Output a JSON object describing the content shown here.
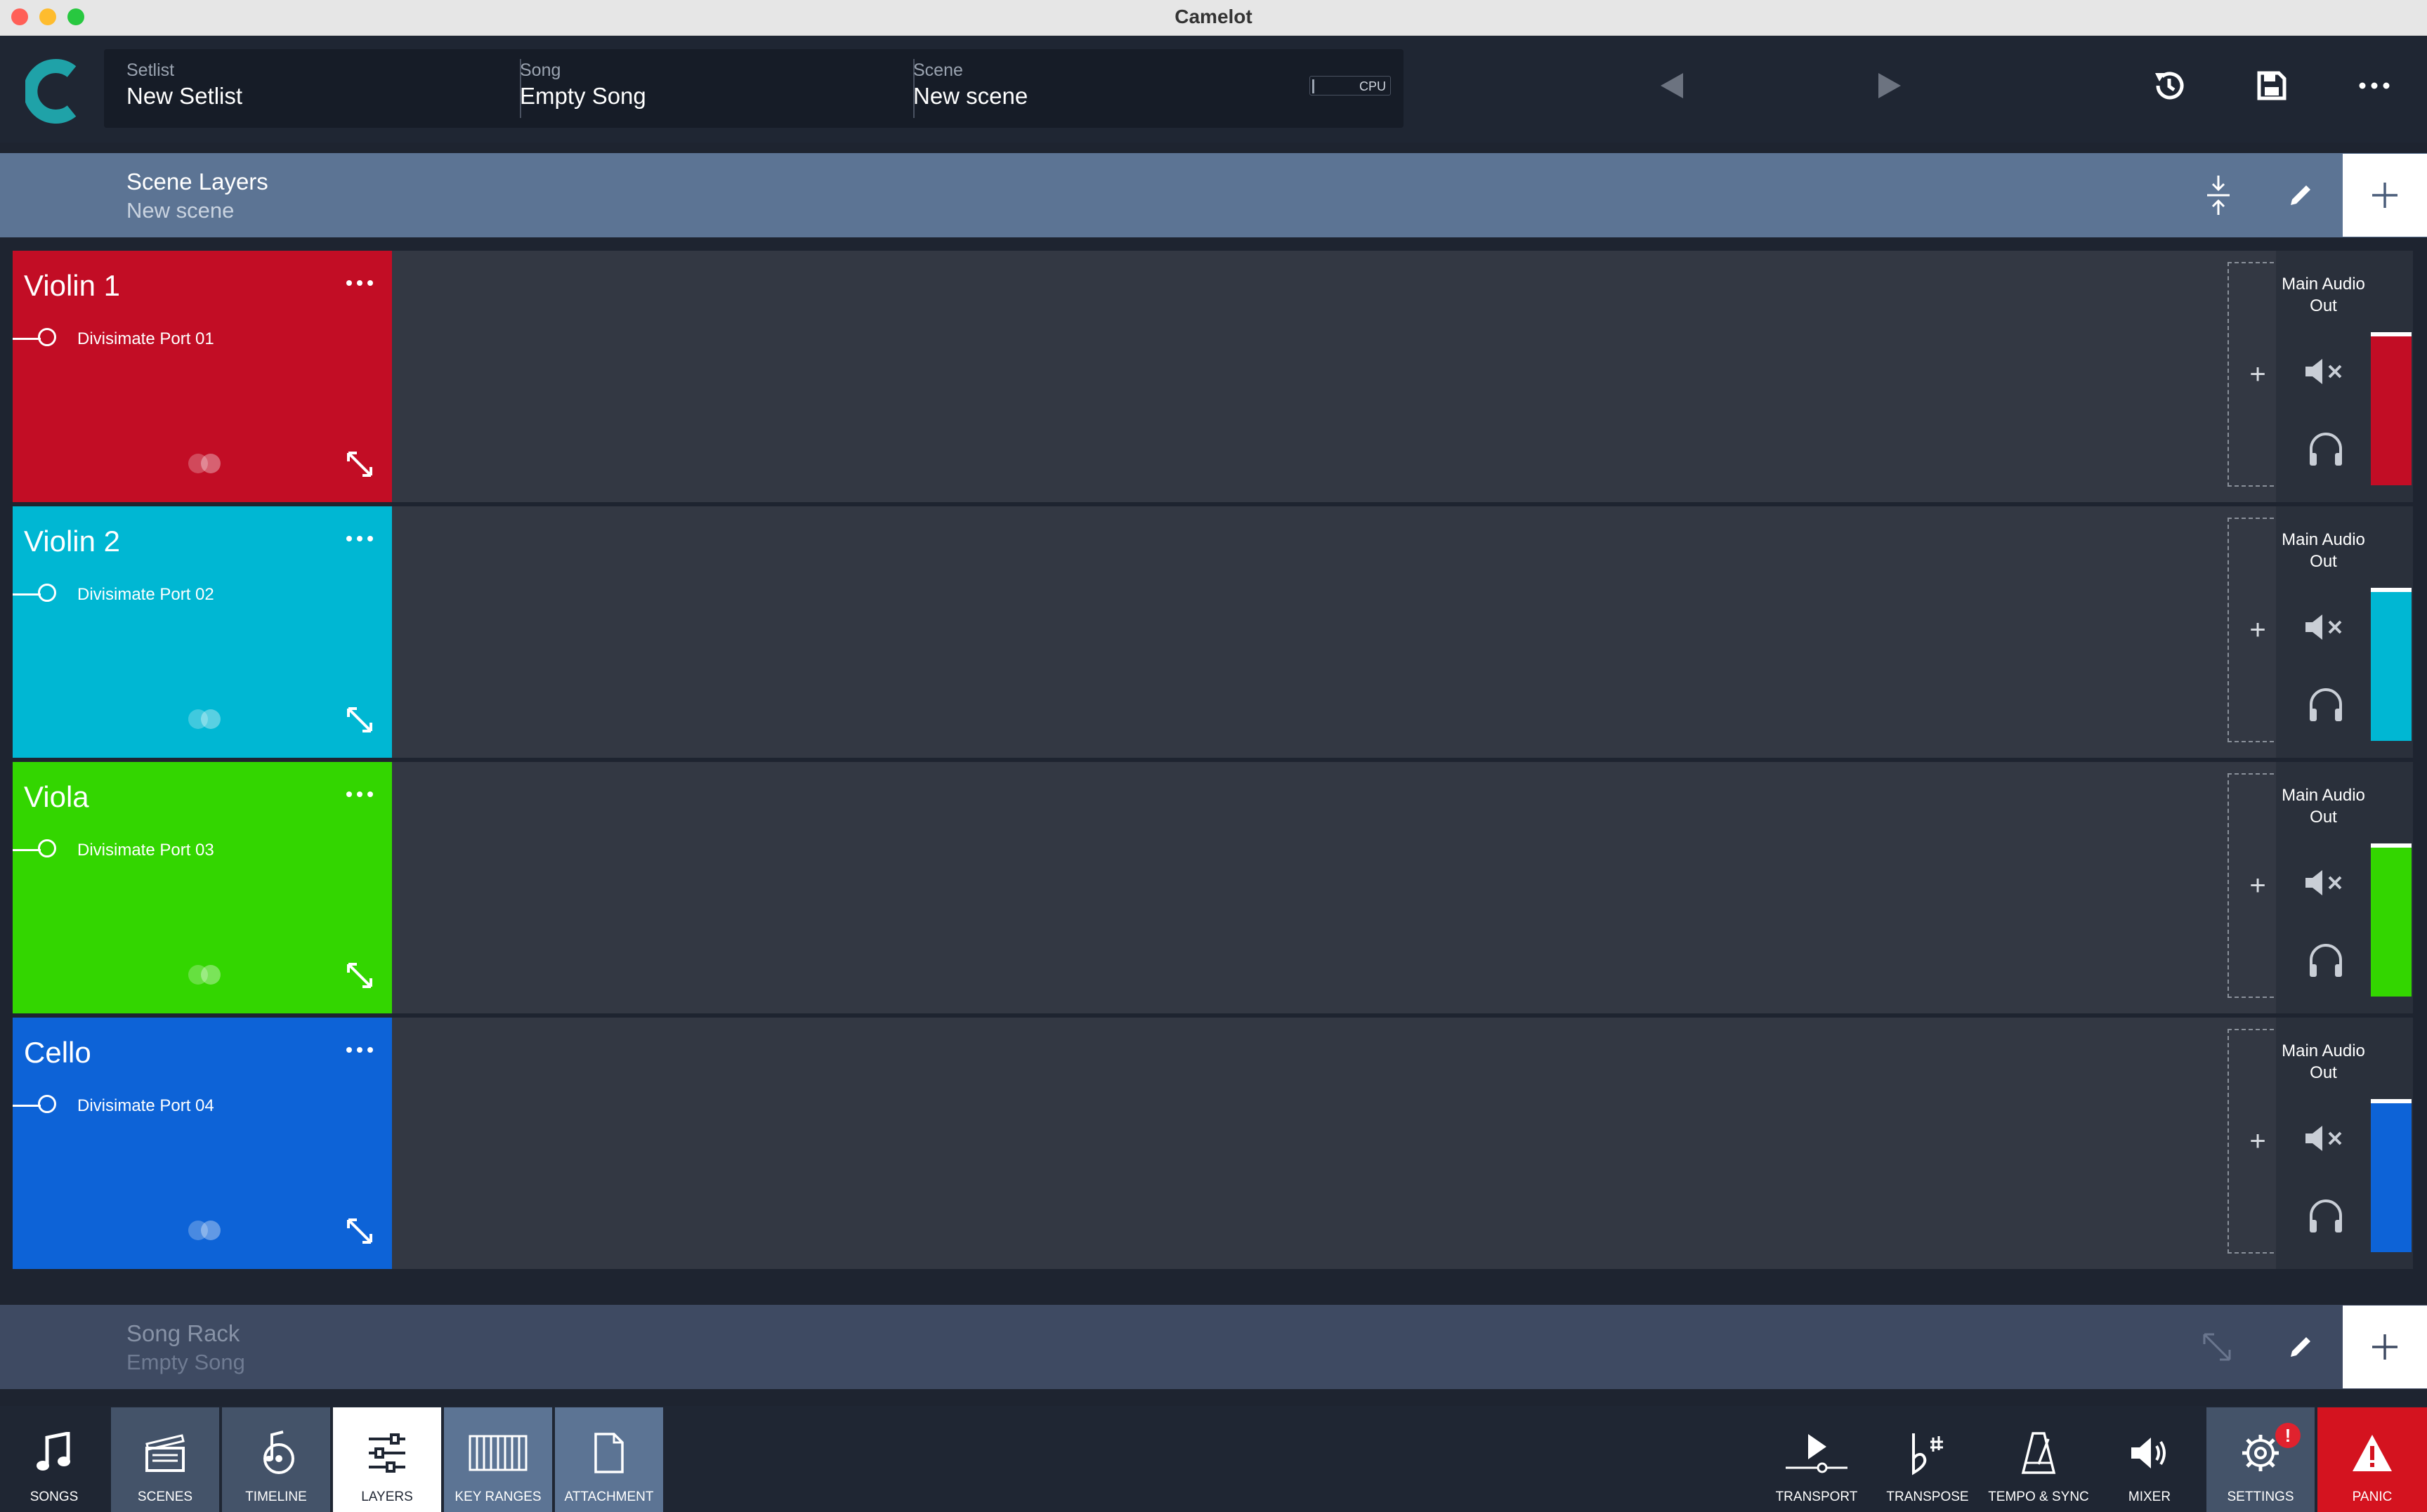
{
  "window": {
    "title": "Camelot"
  },
  "header": {
    "setlist_label": "Setlist",
    "setlist_value": "New Setlist",
    "song_label": "Song",
    "song_value": "Empty Song",
    "scene_label": "Scene",
    "scene_value": "New scene",
    "cpu_label": "CPU"
  },
  "scene_layers": {
    "title": "Scene Layers",
    "subtitle": "New scene"
  },
  "layers": [
    {
      "name": "Violin 1",
      "port": "Divisimate Port 01",
      "output": "Main Audio Out",
      "color": "#c20d25"
    },
    {
      "name": "Violin 2",
      "port": "Divisimate Port 02",
      "output": "Main Audio Out",
      "color": "#00b7d3"
    },
    {
      "name": "Viola",
      "port": "Divisimate Port 03",
      "output": "Main Audio Out",
      "color": "#33d600"
    },
    {
      "name": "Cello",
      "port": "Divisimate Port 04",
      "output": "Main Audio Out",
      "color": "#0d63d7"
    }
  ],
  "song_rack": {
    "title": "Song Rack",
    "subtitle": "Empty Song"
  },
  "toolbar": {
    "left": [
      "SONGS",
      "SCENES",
      "TIMELINE",
      "LAYERS",
      "KEY RANGES",
      "ATTACHMENT"
    ],
    "right": [
      "TRANSPORT",
      "TRANSPOSE",
      "TEMPO & SYNC",
      "MIXER",
      "SETTINGS",
      "PANIC"
    ],
    "active": "LAYERS",
    "settings_badge": "!"
  },
  "colors": {
    "accent": "#1fa2a8",
    "panic": "#d4131f",
    "scene_bar": "#5c7494"
  }
}
